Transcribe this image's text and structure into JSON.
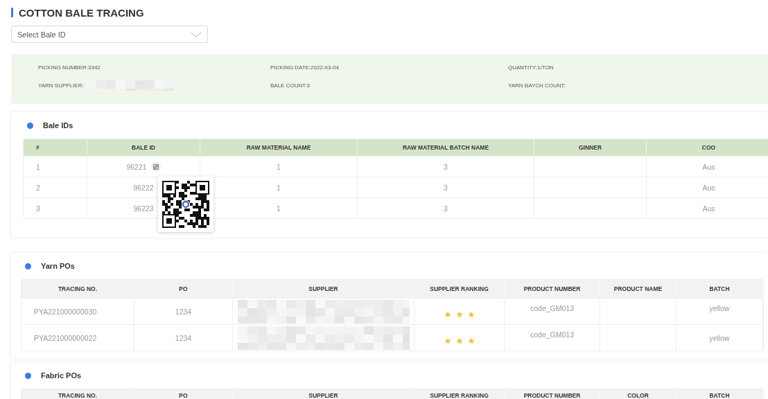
{
  "page": {
    "title": "COTTON BALE TRACING"
  },
  "bale_select": {
    "placeholder": "Select Bale ID"
  },
  "summary": [
    {
      "text": "PICKING NUMBER:3342",
      "value_redacted": false
    },
    {
      "text": "PICKING DATE:2022-03-04",
      "value_redacted": false
    },
    {
      "text": "QUANTITY:1/TON",
      "value_redacted": false
    },
    {
      "text": "YARN SUPPLIER:",
      "value_redacted": true
    },
    {
      "text": "BALE COUNT:3",
      "value_redacted": false
    },
    {
      "text": "YARN BAYCH COUNT:",
      "value_redacted": false
    }
  ],
  "bale_ids": {
    "title": "Bale IDs",
    "columns": [
      "#",
      "BALE ID",
      "RAW MATERIAL NAME",
      "RAW MATERIAL BATCH NAME",
      "GINNER",
      "COO"
    ],
    "rows": [
      {
        "number": "1",
        "bale_id": "96221",
        "raw_material_name": "1",
        "raw_material_batch_name": "3",
        "coo": "Aus",
        "qr_shown": true
      },
      {
        "number": "2",
        "bale_id": "96222",
        "raw_material_name": "1",
        "raw_material_batch_name": "3",
        "coo": "Aus",
        "qr_shown": false
      },
      {
        "number": "3",
        "bale_id": "96223",
        "raw_material_name": "1",
        "raw_material_batch_name": "3",
        "coo": "Aus",
        "qr_shown": false
      }
    ]
  },
  "yarn_pos": {
    "title": "Yarn POs",
    "columns": [
      "TRACING NO.",
      "PO",
      "SUPPLIER",
      "SUPPLIER RANKING",
      "PRODUCT NUMBER",
      "PRODUCT NAME",
      "BATCH"
    ],
    "rows": [
      {
        "tracing_no": "PYA221000000030",
        "po": "1234",
        "supplier_redacted": true,
        "stars": 3,
        "product_number": "code_GM013",
        "batch": "yellow"
      },
      {
        "tracing_no": "PYA221000000022",
        "po": "1234",
        "supplier_redacted": true,
        "stars": 3,
        "product_number": "code_GM013",
        "batch": "yellow"
      }
    ]
  },
  "fabric_pos": {
    "title": "Fabric POs",
    "columns": [
      "TRACING NO.",
      "PO",
      "SUPPLIER",
      "SUPPLIER RANKING",
      "PRODUCT NUMBER",
      "COLOR",
      "BATCH"
    ]
  }
}
